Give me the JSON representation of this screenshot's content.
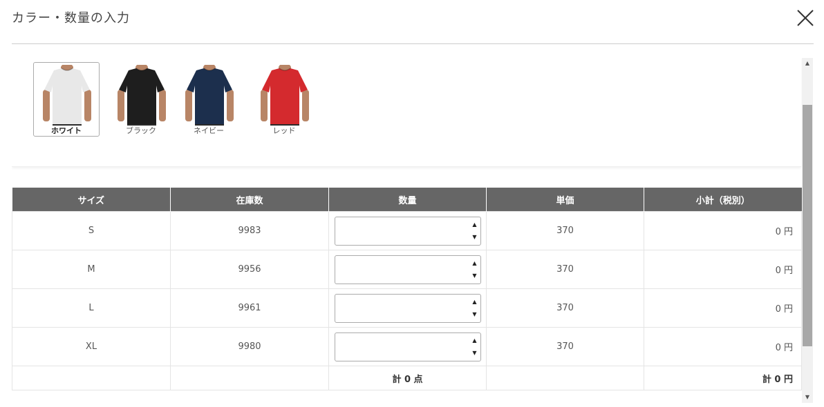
{
  "dialog": {
    "title": "カラー・数量の入力"
  },
  "colors": [
    {
      "label": "ホワイト",
      "fill": "#e8e8e8",
      "selected": true
    },
    {
      "label": "ブラック",
      "fill": "#1e1e1e",
      "selected": false
    },
    {
      "label": "ネイビー",
      "fill": "#1c2f4d",
      "selected": false
    },
    {
      "label": "レッド",
      "fill": "#d42a2e",
      "selected": false
    }
  ],
  "table": {
    "headers": [
      "サイズ",
      "在庫数",
      "数量",
      "単価",
      "小計（税別）"
    ],
    "rows": [
      {
        "size": "S",
        "stock": "9983",
        "qty": "",
        "price": "370",
        "subtotal": "0 円"
      },
      {
        "size": "M",
        "stock": "9956",
        "qty": "",
        "price": "370",
        "subtotal": "0 円"
      },
      {
        "size": "L",
        "stock": "9961",
        "qty": "",
        "price": "370",
        "subtotal": "0 円"
      },
      {
        "size": "XL",
        "stock": "9980",
        "qty": "",
        "price": "370",
        "subtotal": "0 円"
      }
    ],
    "total_qty": "計 0 点",
    "total_price": "計 0 円"
  },
  "icons": {
    "close": "close-icon",
    "spin_up": "spin-up-icon",
    "spin_down": "spin-down-icon"
  }
}
